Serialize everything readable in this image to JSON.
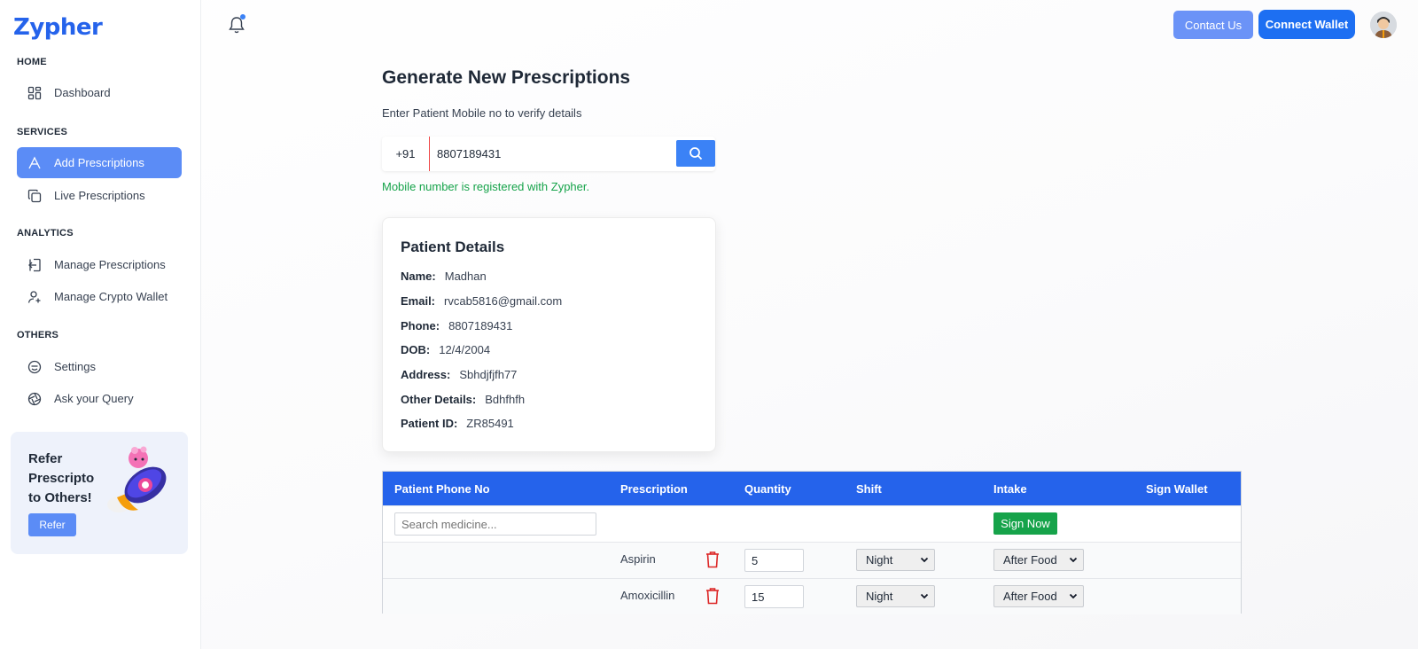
{
  "app": {
    "logo": "Zypher"
  },
  "sidebar": {
    "sections": [
      {
        "title": "HOME"
      },
      {
        "title": "SERVICES"
      },
      {
        "title": "ANALYTICS"
      },
      {
        "title": "OTHERS"
      }
    ],
    "items": [
      {
        "label": "Dashboard",
        "icon": "dashboard-icon"
      },
      {
        "label": "Add Prescriptions",
        "icon": "prescription-icon",
        "active": true
      },
      {
        "label": "Live Prescriptions",
        "icon": "copy-icon"
      },
      {
        "label": "Manage Prescriptions",
        "icon": "logout-icon"
      },
      {
        "label": "Manage Crypto Wallet",
        "icon": "user-add-icon"
      },
      {
        "label": "Settings",
        "icon": "settings-icon"
      },
      {
        "label": "Ask your Query",
        "icon": "aperture-icon"
      }
    ],
    "refer": {
      "text": "Refer\nPrescripto\nto Others!",
      "button": "Refer"
    }
  },
  "header": {
    "contact_label": "Contact Us",
    "connect_label": "Connect Wallet"
  },
  "main": {
    "title": "Generate New Prescriptions",
    "subtitle": "Enter Patient Mobile no to verify details",
    "country_code": "+91",
    "phone_value": "8807189431",
    "verify_message": "Mobile number is registered with Zypher."
  },
  "patient": {
    "title": "Patient Details",
    "fields": [
      {
        "key": "Name:",
        "value": "Madhan"
      },
      {
        "key": "Email:",
        "value": "rvcab5816@gmail.com"
      },
      {
        "key": "Phone:",
        "value": "8807189431"
      },
      {
        "key": "DOB:",
        "value": "12/4/2004"
      },
      {
        "key": "Address:",
        "value": "Sbhdjfjfh77"
      },
      {
        "key": "Other Details:",
        "value": "Bdhfhfh"
      },
      {
        "key": "Patient ID:",
        "value": "ZR85491"
      }
    ]
  },
  "table": {
    "headers": [
      "Patient Phone No",
      "Prescription",
      "Quantity",
      "Shift",
      "Intake",
      "Sign Wallet"
    ],
    "search_placeholder": "Search medicine...",
    "sign_label": "Sign Now",
    "rows": [
      {
        "medicine": "Aspirin",
        "quantity": "5",
        "shift": "Night",
        "intake": "After Food"
      },
      {
        "medicine": "Amoxicillin",
        "quantity": "15",
        "shift": "Night",
        "intake": "After Food"
      }
    ]
  },
  "colors": {
    "accent": "#2563eb",
    "active_nav": "#5b8cf6",
    "success": "#16a34a",
    "danger": "#dc2626"
  }
}
